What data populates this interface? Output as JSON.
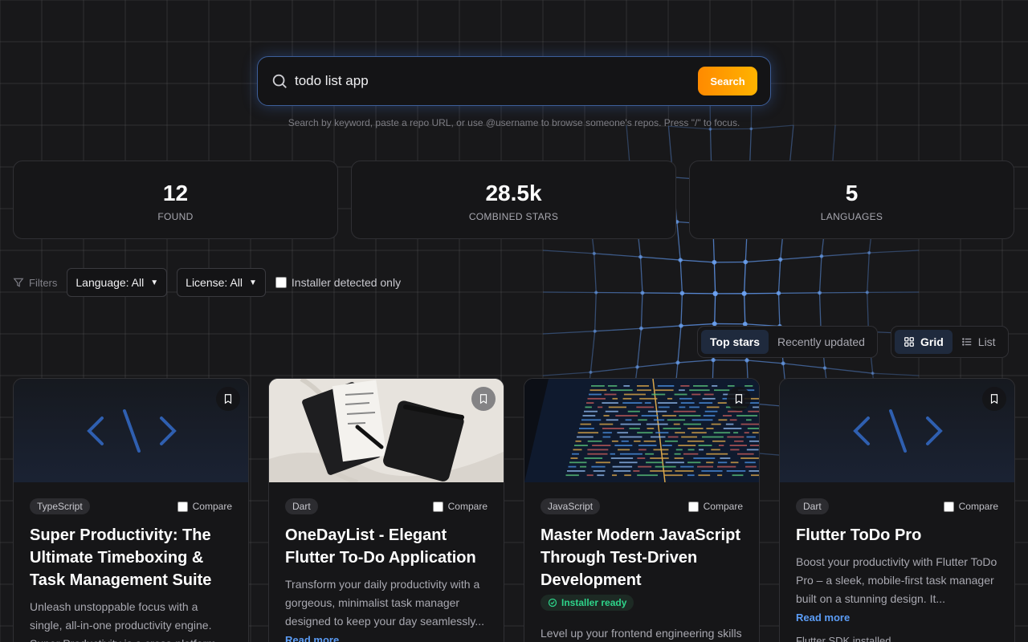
{
  "search": {
    "value": "todo list app",
    "button_label": "Search",
    "hint": "Search by keyword, paste a repo URL, or use @username to browse someone's repos. Press \"/\" to focus."
  },
  "stats": [
    {
      "value": "12",
      "label": "FOUND"
    },
    {
      "value": "28.5k",
      "label": "COMBINED STARS"
    },
    {
      "value": "5",
      "label": "LANGUAGES"
    }
  ],
  "filters": {
    "label": "Filters",
    "language_select": "Language: All",
    "license_select": "License: All",
    "installer_checkbox": "Installer detected only"
  },
  "sort": {
    "top_stars": "Top stars",
    "recently_updated": "Recently updated"
  },
  "view": {
    "grid": "Grid",
    "list": "List"
  },
  "cards": [
    {
      "language": "TypeScript",
      "compare_label": "Compare",
      "title": "Super Productivity: The Ultimate Timeboxing & Task Management Suite",
      "description": "Unleash unstoppable focus with a single, all-in-one productivity engine. Super Productivity is a cross-platform todo a"
    },
    {
      "language": "Dart",
      "compare_label": "Compare",
      "title": "OneDayList - Elegant Flutter To-Do Application",
      "description": "Transform your daily productivity with a gorgeous, minimalist task manager designed to keep your day seamlessly...",
      "read_more": "Read more"
    },
    {
      "language": "JavaScript",
      "compare_label": "Compare",
      "title": "Master Modern JavaScript Through Test-Driven Development",
      "installer_badge": "Installer ready",
      "description": "Level up your frontend engineering skills by building a production-ready Todo"
    },
    {
      "language": "Dart",
      "compare_label": "Compare",
      "title": "Flutter ToDo Pro",
      "description": "Boost your productivity with Flutter ToDo Pro – a sleek, mobile-first task manager built on a stunning design. It...",
      "read_more": "Read more",
      "installer_line": "Flutter SDK installed"
    }
  ],
  "colors": {
    "accent_orange": "#ff8a00",
    "accent_blue": "#5b9cf5",
    "installer_green": "#2ed48a"
  }
}
